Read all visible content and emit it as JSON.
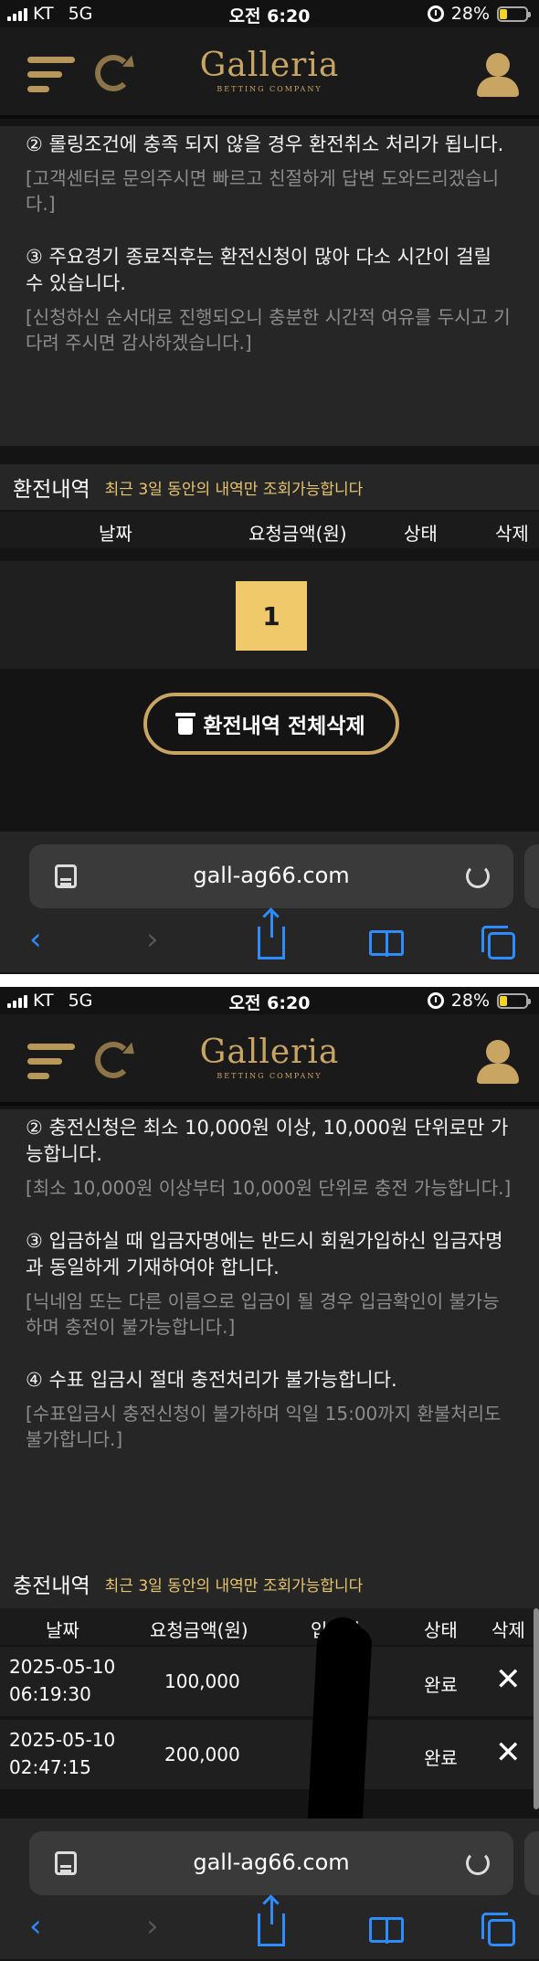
{
  "status": {
    "carrier": "KT",
    "network": "5G",
    "time": "오전 6:20",
    "battery": "28%"
  },
  "header": {
    "logo_main": "Galleria",
    "logo_sub": "BETTING COMPANY"
  },
  "withdraw": {
    "notices": [
      {
        "main": "② 롤링조건에 충족 되지 않을 경우 환전취소 처리가 됩니다.",
        "sub": "[고객센터로 문의주시면 빠르고 친절하게 답변 도와드리겠습니다.]"
      },
      {
        "main": "③ 주요경기 종료직후는 환전신청이 많아 다소 시간이 걸릴 수 있습니다.",
        "sub": "[신청하신 순서대로 진행되오니 충분한 시간적 여유를 두시고 기다려 주시면 감사하겠습니다.]"
      }
    ],
    "history_title": "환전내역",
    "history_note": "최근 3일 동안의 내역만 조회가능합니다",
    "columns": {
      "date": "날짜",
      "amount": "요청금액(원)",
      "status": "상태",
      "delete": "삭제"
    },
    "page": "1",
    "delete_all": "환전내역 전체삭제"
  },
  "deposit": {
    "notices": [
      {
        "main": "② 충전신청은 최소 10,000원 이상, 10,000원 단위로만 가능합니다.",
        "sub": "[최소 10,000원 이상부터 10,000원 단위로 충전 가능합니다.]"
      },
      {
        "main": "③ 입금하실 때 입금자명에는 반드시 회원가입하신 입금자명과 동일하게 기재하여야 합니다.",
        "sub": "[닉네임 또는 다른 이름으로 입금이 될 경우 입금확인이 불가능하며 충전이 불가능합니다.]"
      },
      {
        "main": "④ 수표 입금시 절대 충전처리가 불가능합니다.",
        "sub": "[수표입금시 충전신청이 불가하며 익일 15:00까지 환불처리도 불가합니다.]"
      }
    ],
    "history_title": "충전내역",
    "history_note": "최근 3일 동안의 내역만 조회가능합니다",
    "columns": {
      "date": "날짜",
      "amount": "요청금액(원)",
      "depositor": "입금자",
      "status": "상태",
      "delete": "삭제"
    },
    "rows": [
      {
        "date": "2025-05-10",
        "time": "06:19:30",
        "amount": "100,000",
        "status": "완료"
      },
      {
        "date": "2025-05-10",
        "time": "02:47:15",
        "amount": "200,000",
        "status": "완료"
      }
    ]
  },
  "browser": {
    "url": "gall-ag66.com"
  },
  "colors": {
    "accent": "#c9a564",
    "page_button": "#f0c96b",
    "note": "#e7c56f",
    "ios_blue": "#2f8cff"
  },
  "icons": [
    "menu-icon",
    "refresh-icon",
    "user-icon",
    "trash-icon",
    "close-icon",
    "reader-icon",
    "reload-icon",
    "back-icon",
    "forward-icon",
    "share-icon",
    "bookmarks-icon",
    "tabs-icon"
  ]
}
